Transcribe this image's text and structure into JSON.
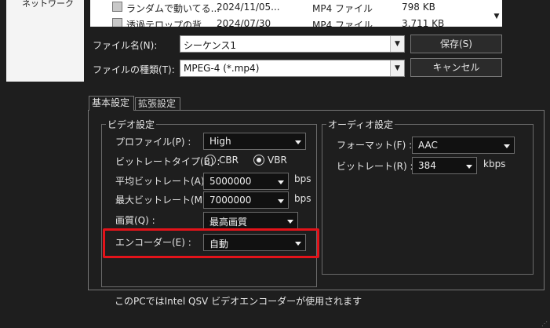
{
  "nav": {
    "network_label": "ネットワーク"
  },
  "file_list": {
    "rows": [
      {
        "name": "ランダムで動いてる...",
        "date": "2024/11/05...",
        "type": "MP4 ファイル",
        "size": "798 KB"
      },
      {
        "name": "透過テロップの背...",
        "date": "2024/07/30",
        "type": "MP4 ファイル",
        "size": "3,711 KB"
      }
    ]
  },
  "save_form": {
    "filename_label": "ファイル名(N):",
    "filename_value": "シーケンス1",
    "filetype_label": "ファイルの種類(T):",
    "filetype_value": "MPEG-4 (*.mp4)",
    "save_button": "保存(S)",
    "cancel_button": "キャンセル"
  },
  "tabs": [
    {
      "label": "基本設定",
      "active": true
    },
    {
      "label": "拡張設定",
      "active": false
    }
  ],
  "video": {
    "group_title": "ビデオ設定",
    "profile_label": "プロファイル(P) :",
    "profile_value": "High",
    "bitrate_type_label": "ビットレートタイプ(B) :",
    "cbr_label": "CBR",
    "vbr_label": "VBR",
    "selected_bitrate_type": "VBR",
    "avg_bitrate_label": "平均ビットレート(A) :",
    "avg_bitrate_value": "5000000",
    "max_bitrate_label": "最大ビットレート(M) :",
    "max_bitrate_value": "7000000",
    "bitrate_unit": "bps",
    "quality_label": "画質(Q) :",
    "quality_value": "最高画質",
    "encoder_label": "エンコーダー(E) :",
    "encoder_value": "自動"
  },
  "audio": {
    "group_title": "オーディオ設定",
    "format_label": "フォーマット(F) :",
    "format_value": "AAC",
    "bitrate_label": "ビットレート(R) :",
    "bitrate_value": "384",
    "bitrate_unit": "kbps"
  },
  "status_note": "このPCではIntel QSV ビデオエンコーダーが使用されます",
  "colors": {
    "highlight": "#e3131a",
    "background": "#1e1e1e"
  }
}
